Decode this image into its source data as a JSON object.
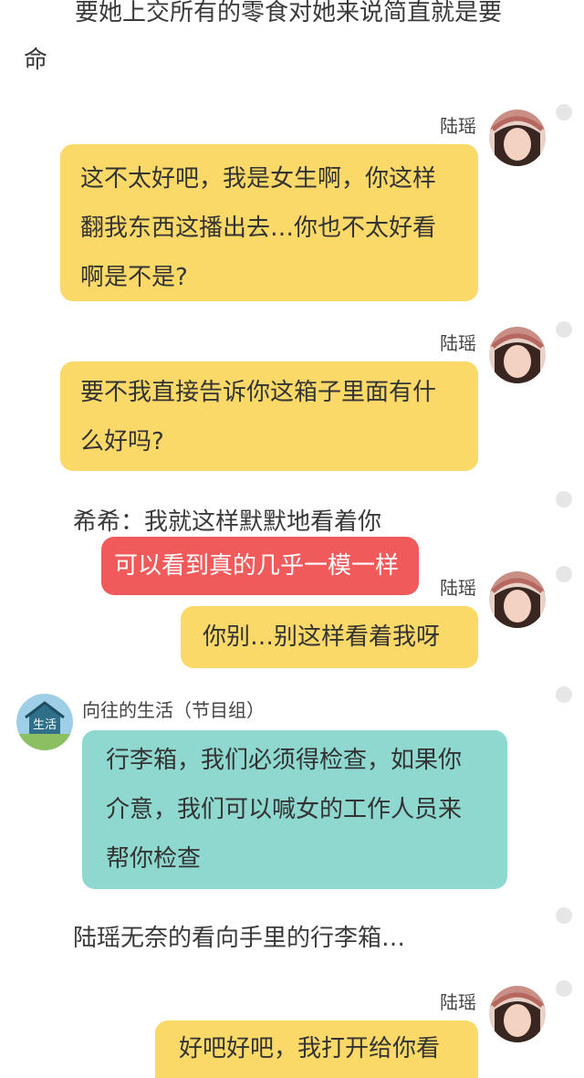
{
  "narration": {
    "top_line1": "要她上交所有的零食对她来说简直就是要",
    "top_line2": "命",
    "mid": "陆瑶无奈的看向手里的行李箱…"
  },
  "messages": [
    {
      "speaker": "陆瑶",
      "text": "这不太好吧，我是女生啊，你这样翻我东西这播出去…你也不太好看啊是不是?"
    },
    {
      "speaker": "陆瑶",
      "text": "要不我直接告诉你这箱子里面有什么好吗?"
    },
    {
      "speaker": "希希：",
      "text": "我就这样默默地看着你"
    },
    {
      "speaker": "",
      "text": "可以看到真的几乎一模一样"
    },
    {
      "speaker": "陆瑶",
      "text": "你别…别这样看着我呀"
    },
    {
      "speaker": "向往的生活（节目组）",
      "text": "行李箱，我们必须得检查，如果你介意，我们可以喊女的工作人员来帮你检查"
    },
    {
      "speaker": "陆瑶",
      "text": "好吧好吧，我打开给你看"
    }
  ],
  "logo_text": "生活",
  "colors": {
    "yellow_bubble": "#fbd968",
    "red_bubble": "#f05a5a",
    "teal_bubble": "#8ed8cf"
  }
}
